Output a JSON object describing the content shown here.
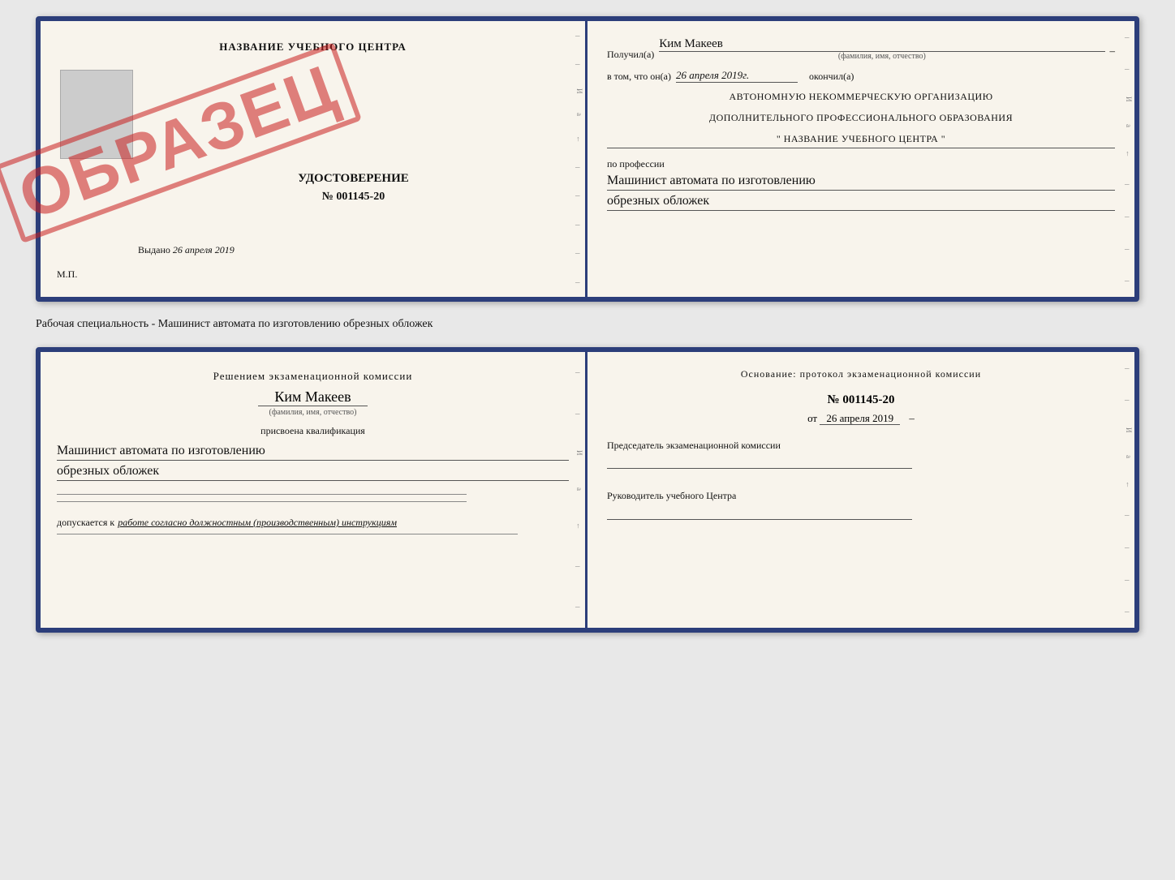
{
  "doc1": {
    "left": {
      "title": "НАЗВАНИЕ УЧЕБНОГО ЦЕНТРА",
      "stamp": "ОБРАЗЕЦ",
      "cert_title": "УДОСТОВЕРЕНИЕ",
      "cert_number": "№ 001145-20",
      "issue_prefix": "Выдано",
      "issue_date": "26 апреля 2019",
      "mp_label": "М.П."
    },
    "right": {
      "received_label": "Получил(а)",
      "recipient_name": "Ким Макеев",
      "name_sub": "(фамилия, имя, отчество)",
      "in_that_prefix": "в том, что он(а)",
      "date_value": "26 апреля 2019г.",
      "finished_label": "окончил(а)",
      "org_line1": "АВТОНОМНУЮ НЕКОММЕРЧЕСКУЮ ОРГАНИЗАЦИЮ",
      "org_line2": "ДОПОЛНИТЕЛЬНОГО ПРОФЕССИОНАЛЬНОГО ОБРАЗОВАНИЯ",
      "org_line3": "\"   НАЗВАНИЕ УЧЕБНОГО ЦЕНТРА   \"",
      "profession_label": "по профессии",
      "profession_line1": "Машинист автомата по изготовлению",
      "profession_line2": "обрезных обложек"
    }
  },
  "between_label": "Рабочая специальность - Машинист автомата по изготовлению обрезных обложек",
  "doc2": {
    "left": {
      "decision_text": "Решением экзаменационной комиссии",
      "person_name": "Ким Макеев",
      "name_sub": "(фамилия, имя, отчество)",
      "qualification_label": "присвоена квалификация",
      "qualification_line1": "Машинист автомата по изготовлению",
      "qualification_line2": "обрезных обложек",
      "access_label": "допускается к",
      "access_text": "работе согласно должностным (производственным) инструкциям"
    },
    "right": {
      "basis_label": "Основание: протокол экзаменационной комиссии",
      "protocol_number": "№  001145-20",
      "date_prefix": "от",
      "date_value": "26 апреля 2019",
      "chairman_label": "Председатель экзаменационной комиссии",
      "director_label": "Руководитель учебного Центра"
    }
  }
}
